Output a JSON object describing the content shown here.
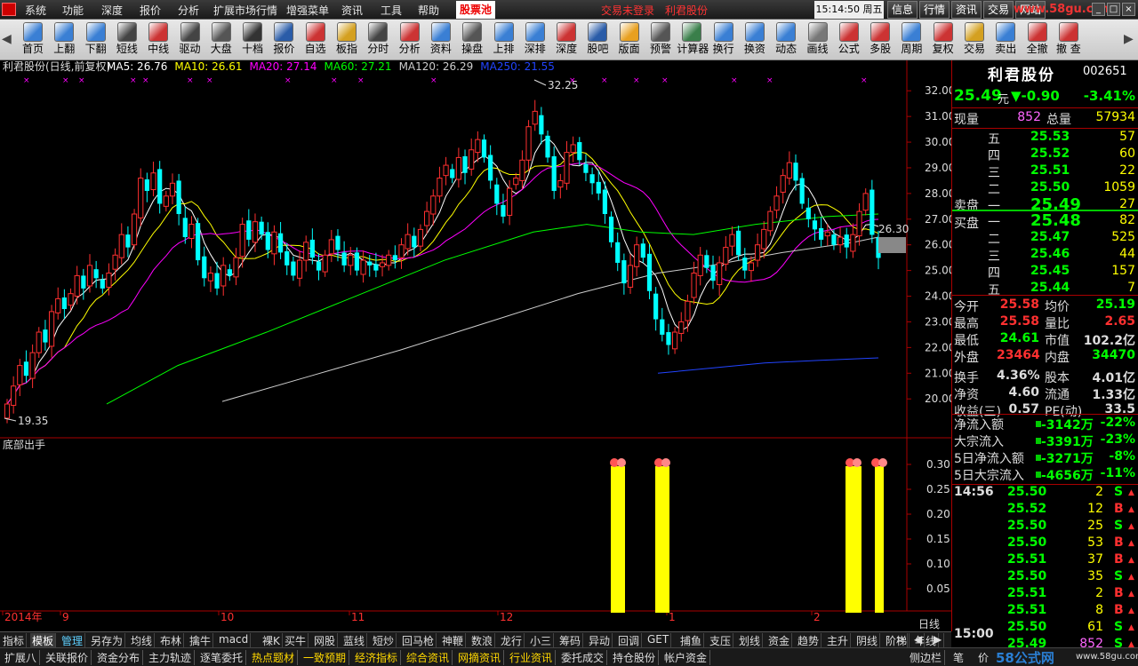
{
  "menu": {
    "items": [
      "系统",
      "功能",
      "深度",
      "报价",
      "分析",
      "扩展市场行情",
      "增强菜单",
      "资讯",
      "工具",
      "帮助"
    ],
    "active": "股票池",
    "trade_status": "交易未登录　利君股份",
    "clock": "15:14:50 周五",
    "right_tabs": [
      "信息",
      "行情",
      "资讯",
      "交易",
      "网站"
    ],
    "watermark": "www.58gu.com"
  },
  "toolbar": {
    "buttons": [
      {
        "label": "首页",
        "color": "#3a7fd4"
      },
      {
        "label": "上翻",
        "color": "#3a7fd4"
      },
      {
        "label": "下翻",
        "color": "#3a7fd4"
      },
      {
        "label": "短线",
        "color": "#444"
      },
      {
        "label": "中线",
        "color": "#c33"
      },
      {
        "label": "驱动",
        "color": "#444"
      },
      {
        "label": "大盘",
        "color": "#555"
      },
      {
        "label": "十档",
        "color": "#333"
      },
      {
        "label": "报价",
        "color": "#2a5ca8"
      },
      {
        "label": "自选",
        "color": "#c33"
      },
      {
        "label": "板指",
        "color": "#d4a020"
      },
      {
        "label": "分时",
        "color": "#444"
      },
      {
        "label": "分析",
        "color": "#c33"
      },
      {
        "label": "资料",
        "color": "#3a7fd4"
      },
      {
        "label": "操盘",
        "color": "#555"
      },
      {
        "label": "上排",
        "color": "#3a7fd4"
      },
      {
        "label": "深排",
        "color": "#3a7fd4"
      },
      {
        "label": "深度",
        "color": "#c33"
      },
      {
        "label": "股吧",
        "color": "#2a5ca8"
      },
      {
        "label": "版面",
        "color": "#e8a020"
      },
      {
        "label": "预警",
        "color": "#555"
      },
      {
        "label": "计算器",
        "color": "#3a7f4a"
      },
      {
        "label": "换行",
        "color": "#3a7fd4"
      },
      {
        "label": "换资",
        "color": "#3a7fd4"
      },
      {
        "label": "动态",
        "color": "#3a7fd4"
      },
      {
        "label": "画线",
        "color": "#777"
      },
      {
        "label": "公式",
        "color": "#c33"
      },
      {
        "label": "多股",
        "color": "#c33"
      },
      {
        "label": "周期",
        "color": "#3a7fd4"
      },
      {
        "label": "复权",
        "color": "#c33"
      },
      {
        "label": "交易",
        "color": "#d4a020"
      },
      {
        "label": "卖出",
        "color": "#3a7fd4"
      },
      {
        "label": "全撤",
        "color": "#c33"
      },
      {
        "label": "撤 查",
        "color": "#c33"
      }
    ],
    "icon_f6": "F6",
    "icon_f10": "F10",
    "icon_f9": "F9",
    "icon_l2": "L2",
    "icon_10": "10"
  },
  "chart": {
    "title": "利君股份(日线,前复权)",
    "ma": [
      {
        "label": "MA5: 26.76",
        "color": "#ffffff"
      },
      {
        "label": "MA10: 26.61",
        "color": "#ffff00"
      },
      {
        "label": "MA20: 27.14",
        "color": "#ff00ff"
      },
      {
        "label": "MA60: 27.21",
        "color": "#00ff00"
      },
      {
        "label": "MA120: 26.29",
        "color": "#cccccc"
      },
      {
        "label": "MA250: 21.55",
        "color": "#2244ff"
      }
    ],
    "high_label": "32.25",
    "low_label": "19.35",
    "current_price_label": "26.30",
    "price_axis": [
      "32.00",
      "31.00",
      "30.00",
      "29.00",
      "28.00",
      "27.00",
      "26.00",
      "25.00",
      "24.00",
      "23.00",
      "22.00",
      "21.00",
      "20.00"
    ],
    "indicator_title": "底部出手",
    "indicator_axis": [
      "0.30",
      "0.25",
      "0.20",
      "0.15",
      "0.10",
      "0.05"
    ],
    "x_labels": [
      "2014年",
      "9",
      "10",
      "11",
      "12",
      "1",
      "2"
    ],
    "period": "日线",
    "up_color": "#ff3030",
    "down_color": "#00ffff"
  },
  "chart_data": {
    "type": "candlestick",
    "series": [
      {
        "name": "MA5",
        "color": "#ffffff"
      },
      {
        "name": "MA10",
        "color": "#ffff00"
      },
      {
        "name": "MA20",
        "color": "#ff00ff"
      },
      {
        "name": "MA60",
        "color": "#00ff00"
      },
      {
        "name": "MA120",
        "color": "#cccccc"
      },
      {
        "name": "MA250",
        "color": "#2244ff"
      }
    ],
    "y_range": [
      19.35,
      32.25
    ]
  },
  "quote": {
    "name": "利君股份",
    "code": "002651",
    "price": "25.49",
    "unit": "元",
    "change": "▼-0.90",
    "pct": "-3.41%",
    "now_vol_label": "现量",
    "now_vol": "852",
    "total_vol_label": "总量",
    "total_vol": "57934",
    "sell_label": "卖盘",
    "buy_label": "买盘",
    "asks": [
      {
        "n": "五",
        "p": "25.53",
        "v": "57"
      },
      {
        "n": "四",
        "p": "25.52",
        "v": "60"
      },
      {
        "n": "三",
        "p": "25.51",
        "v": "22"
      },
      {
        "n": "二",
        "p": "25.50",
        "v": "1059"
      },
      {
        "n": "一",
        "p": "25.49",
        "v": "27"
      }
    ],
    "bids": [
      {
        "n": "一",
        "p": "25.48",
        "v": "82"
      },
      {
        "n": "二",
        "p": "25.47",
        "v": "525"
      },
      {
        "n": "三",
        "p": "25.46",
        "v": "44"
      },
      {
        "n": "四",
        "p": "25.45",
        "v": "157"
      },
      {
        "n": "五",
        "p": "25.44",
        "v": "7"
      }
    ],
    "stats": [
      {
        "l1": "今开",
        "v1": "25.58",
        "c1": "#ff3030",
        "l2": "均价",
        "v2": "25.19",
        "c2": "#00ff00"
      },
      {
        "l1": "最高",
        "v1": "25.58",
        "c1": "#ff3030",
        "l2": "量比",
        "v2": "2.65",
        "c2": "#ff3030"
      },
      {
        "l1": "最低",
        "v1": "24.61",
        "c1": "#00ff00",
        "l2": "市值",
        "v2": "102.2亿",
        "c2": "#ddd"
      },
      {
        "l1": "外盘",
        "v1": "23464",
        "c1": "#ff3030",
        "l2": "内盘",
        "v2": "34470",
        "c2": "#00ff00"
      },
      {
        "l1": "换手",
        "v1": "4.36%",
        "c1": "#ddd",
        "l2": "股本",
        "v2": "4.01亿",
        "c2": "#ddd"
      },
      {
        "l1": "净资",
        "v1": "4.60",
        "c1": "#ddd",
        "l2": "流通",
        "v2": "1.33亿",
        "c2": "#ddd"
      },
      {
        "l1": "收益(三)",
        "v1": "0.57",
        "c1": "#ddd",
        "l2": "PE(动)",
        "v2": "33.5",
        "c2": "#ddd"
      }
    ],
    "flows": [
      {
        "l": "净流入额",
        "v": "-3142万",
        "p": "-22%"
      },
      {
        "l": "大宗流入",
        "v": "-3391万",
        "p": "-23%"
      },
      {
        "l": "5日净流入额",
        "v": "-3271万",
        "p": "-8%"
      },
      {
        "l": "5日大宗流入",
        "v": "-4656万",
        "p": "-11%"
      }
    ],
    "ticks_time": "14:56",
    "ticks_end": "15:00",
    "ticks_last_vol": "852",
    "ticks": [
      {
        "p": "25.50",
        "v": "2",
        "s": "S"
      },
      {
        "p": "25.52",
        "v": "12",
        "s": "B"
      },
      {
        "p": "25.50",
        "v": "25",
        "s": "S"
      },
      {
        "p": "25.50",
        "v": "53",
        "s": "B"
      },
      {
        "p": "25.51",
        "v": "37",
        "s": "B"
      },
      {
        "p": "25.50",
        "v": "35",
        "s": "S"
      },
      {
        "p": "25.51",
        "v": "2",
        "s": "B"
      },
      {
        "p": "25.51",
        "v": "8",
        "s": "B"
      },
      {
        "p": "25.50",
        "v": "61",
        "s": "S"
      },
      {
        "p": "25.49",
        "v": "852",
        "s": "S"
      }
    ]
  },
  "tabs1": [
    "指标",
    "模板",
    "管理",
    "另存为",
    "均线",
    "布林",
    "擒牛",
    "macd",
    "裸K",
    "买牛",
    "网股",
    "蓝线",
    "短炒",
    "回马枪",
    "神鞭",
    "数浪",
    "龙行",
    "小三",
    "筹码",
    "异动",
    "回调",
    "GET",
    "捕鱼",
    "支压",
    "划线",
    "资金",
    "趋势",
    "主升",
    "阴线",
    "阶梯",
    "年线"
  ],
  "tabs2": [
    {
      "t": "扩展八",
      "y": false
    },
    {
      "t": "关联报价",
      "y": false
    },
    {
      "t": "资金分布",
      "y": false
    },
    {
      "t": "主力轨迹",
      "y": false
    },
    {
      "t": "逐笔委托",
      "y": false
    },
    {
      "t": "热点题材",
      "y": true
    },
    {
      "t": "一致预期",
      "y": true
    },
    {
      "t": "经济指标",
      "y": true
    },
    {
      "t": "综合资讯",
      "y": true
    },
    {
      "t": "网摘资讯",
      "y": true
    },
    {
      "t": "行业资讯",
      "y": true
    },
    {
      "t": "委托成交",
      "y": false
    },
    {
      "t": "持仓股份",
      "y": false
    },
    {
      "t": "帐户资金",
      "y": false
    }
  ],
  "side_label": "侧边栏",
  "bottom_brand": "58公式网",
  "bottom_url": "www.58gu.com",
  "pen_label": "笔",
  "price_label": "价"
}
